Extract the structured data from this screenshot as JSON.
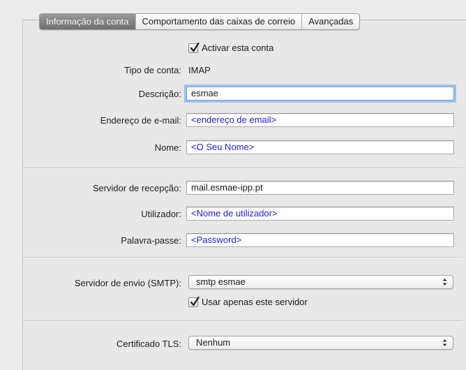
{
  "tabs": [
    {
      "label": "Informação da conta",
      "active": true
    },
    {
      "label": "Comportamento das caixas de correio",
      "active": false
    },
    {
      "label": "Avançadas",
      "active": false
    }
  ],
  "enable_account": {
    "label": "Activar esta conta",
    "checked": true
  },
  "account_type": {
    "label": "Tipo de conta:",
    "value": "IMAP"
  },
  "description": {
    "label": "Descrição:",
    "value": "esmae"
  },
  "email": {
    "label": "Endereço de e-mail:",
    "placeholder": "<endereço de email>"
  },
  "name": {
    "label": "Nome:",
    "placeholder": "<O Seu Nome>"
  },
  "incoming_server": {
    "label": "Servidor de recepção:",
    "value": "mail.esmae-ipp.pt"
  },
  "username": {
    "label": "Utilizador:",
    "placeholder": "<Nome de utilizador>"
  },
  "password": {
    "label": "Palavra-passe:",
    "placeholder": "<Password>"
  },
  "smtp": {
    "label": "Servidor de envio (SMTP):",
    "selected": "smtp esmae"
  },
  "only_this_server": {
    "label": "Usar apenas este servidor",
    "checked": true
  },
  "tls": {
    "label": "Certificado TLS:",
    "selected": "Nenhum"
  },
  "colors": {
    "placeholder_text": "#1c1cd8",
    "focus_ring": "#9ec2ee",
    "active_tab": "#7f7f7f"
  }
}
